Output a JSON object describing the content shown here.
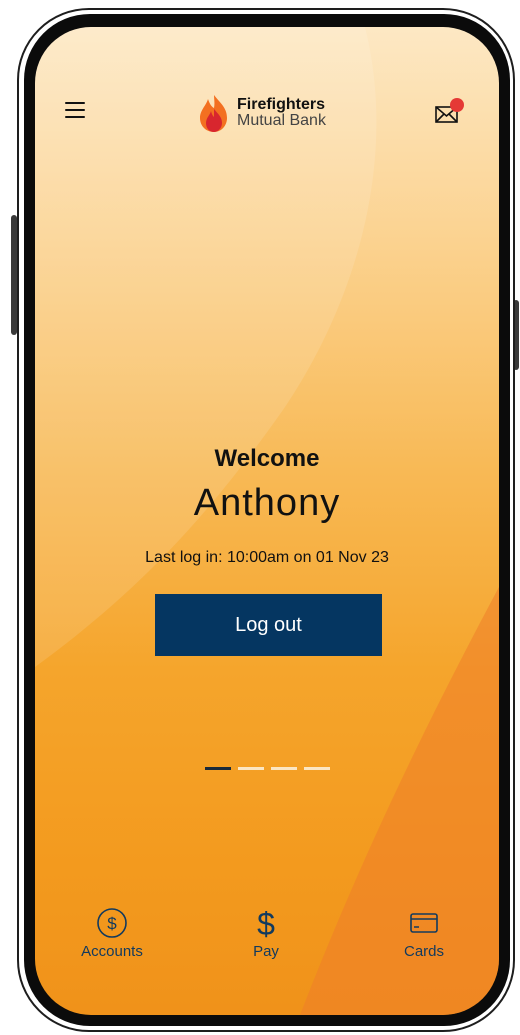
{
  "header": {
    "brand_line1": "Firefighters",
    "brand_line2": "Mutual Bank"
  },
  "welcome": {
    "title": "Welcome",
    "name": "Anthony",
    "last_login": "Last log in: 10:00am on 01 Nov 23",
    "logout_label": "Log out"
  },
  "carousel": {
    "pages": 4,
    "active_index": 0
  },
  "bottom_nav": {
    "items": [
      {
        "label": "Accounts",
        "icon": "dollar-circle-icon"
      },
      {
        "label": "Pay",
        "icon": "dollar-icon"
      },
      {
        "label": "Cards",
        "icon": "card-icon"
      }
    ]
  },
  "colors": {
    "primary_button": "#053661",
    "accent_orange": "#f39a1e",
    "nav_icon": "#123a5e",
    "notification": "#e53935"
  }
}
